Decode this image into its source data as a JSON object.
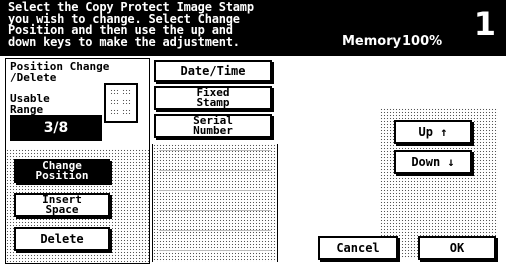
{
  "header": {
    "message": "Select the Copy Protect Image Stamp\nyou wish to change. Select Change\nPosition and then use the up and\ndown keys to make the adjustment.",
    "memory_label": "Memory",
    "memory_value": "100%",
    "page_number": "1"
  },
  "left": {
    "title": "Position Change\n/Delete",
    "usable_range_label": "Usable\nRange",
    "range_value": "3/8",
    "buttons": {
      "change_position": "Change\nPosition",
      "insert_space": "Insert\nSpace",
      "delete": "Delete"
    }
  },
  "middle": {
    "items": [
      "Date/Time",
      "Fixed\nStamp",
      "Serial\nNumber"
    ]
  },
  "right": {
    "up": "Up ↑",
    "down": "Down ↓"
  },
  "footer": {
    "cancel": "Cancel",
    "ok": "OK"
  }
}
